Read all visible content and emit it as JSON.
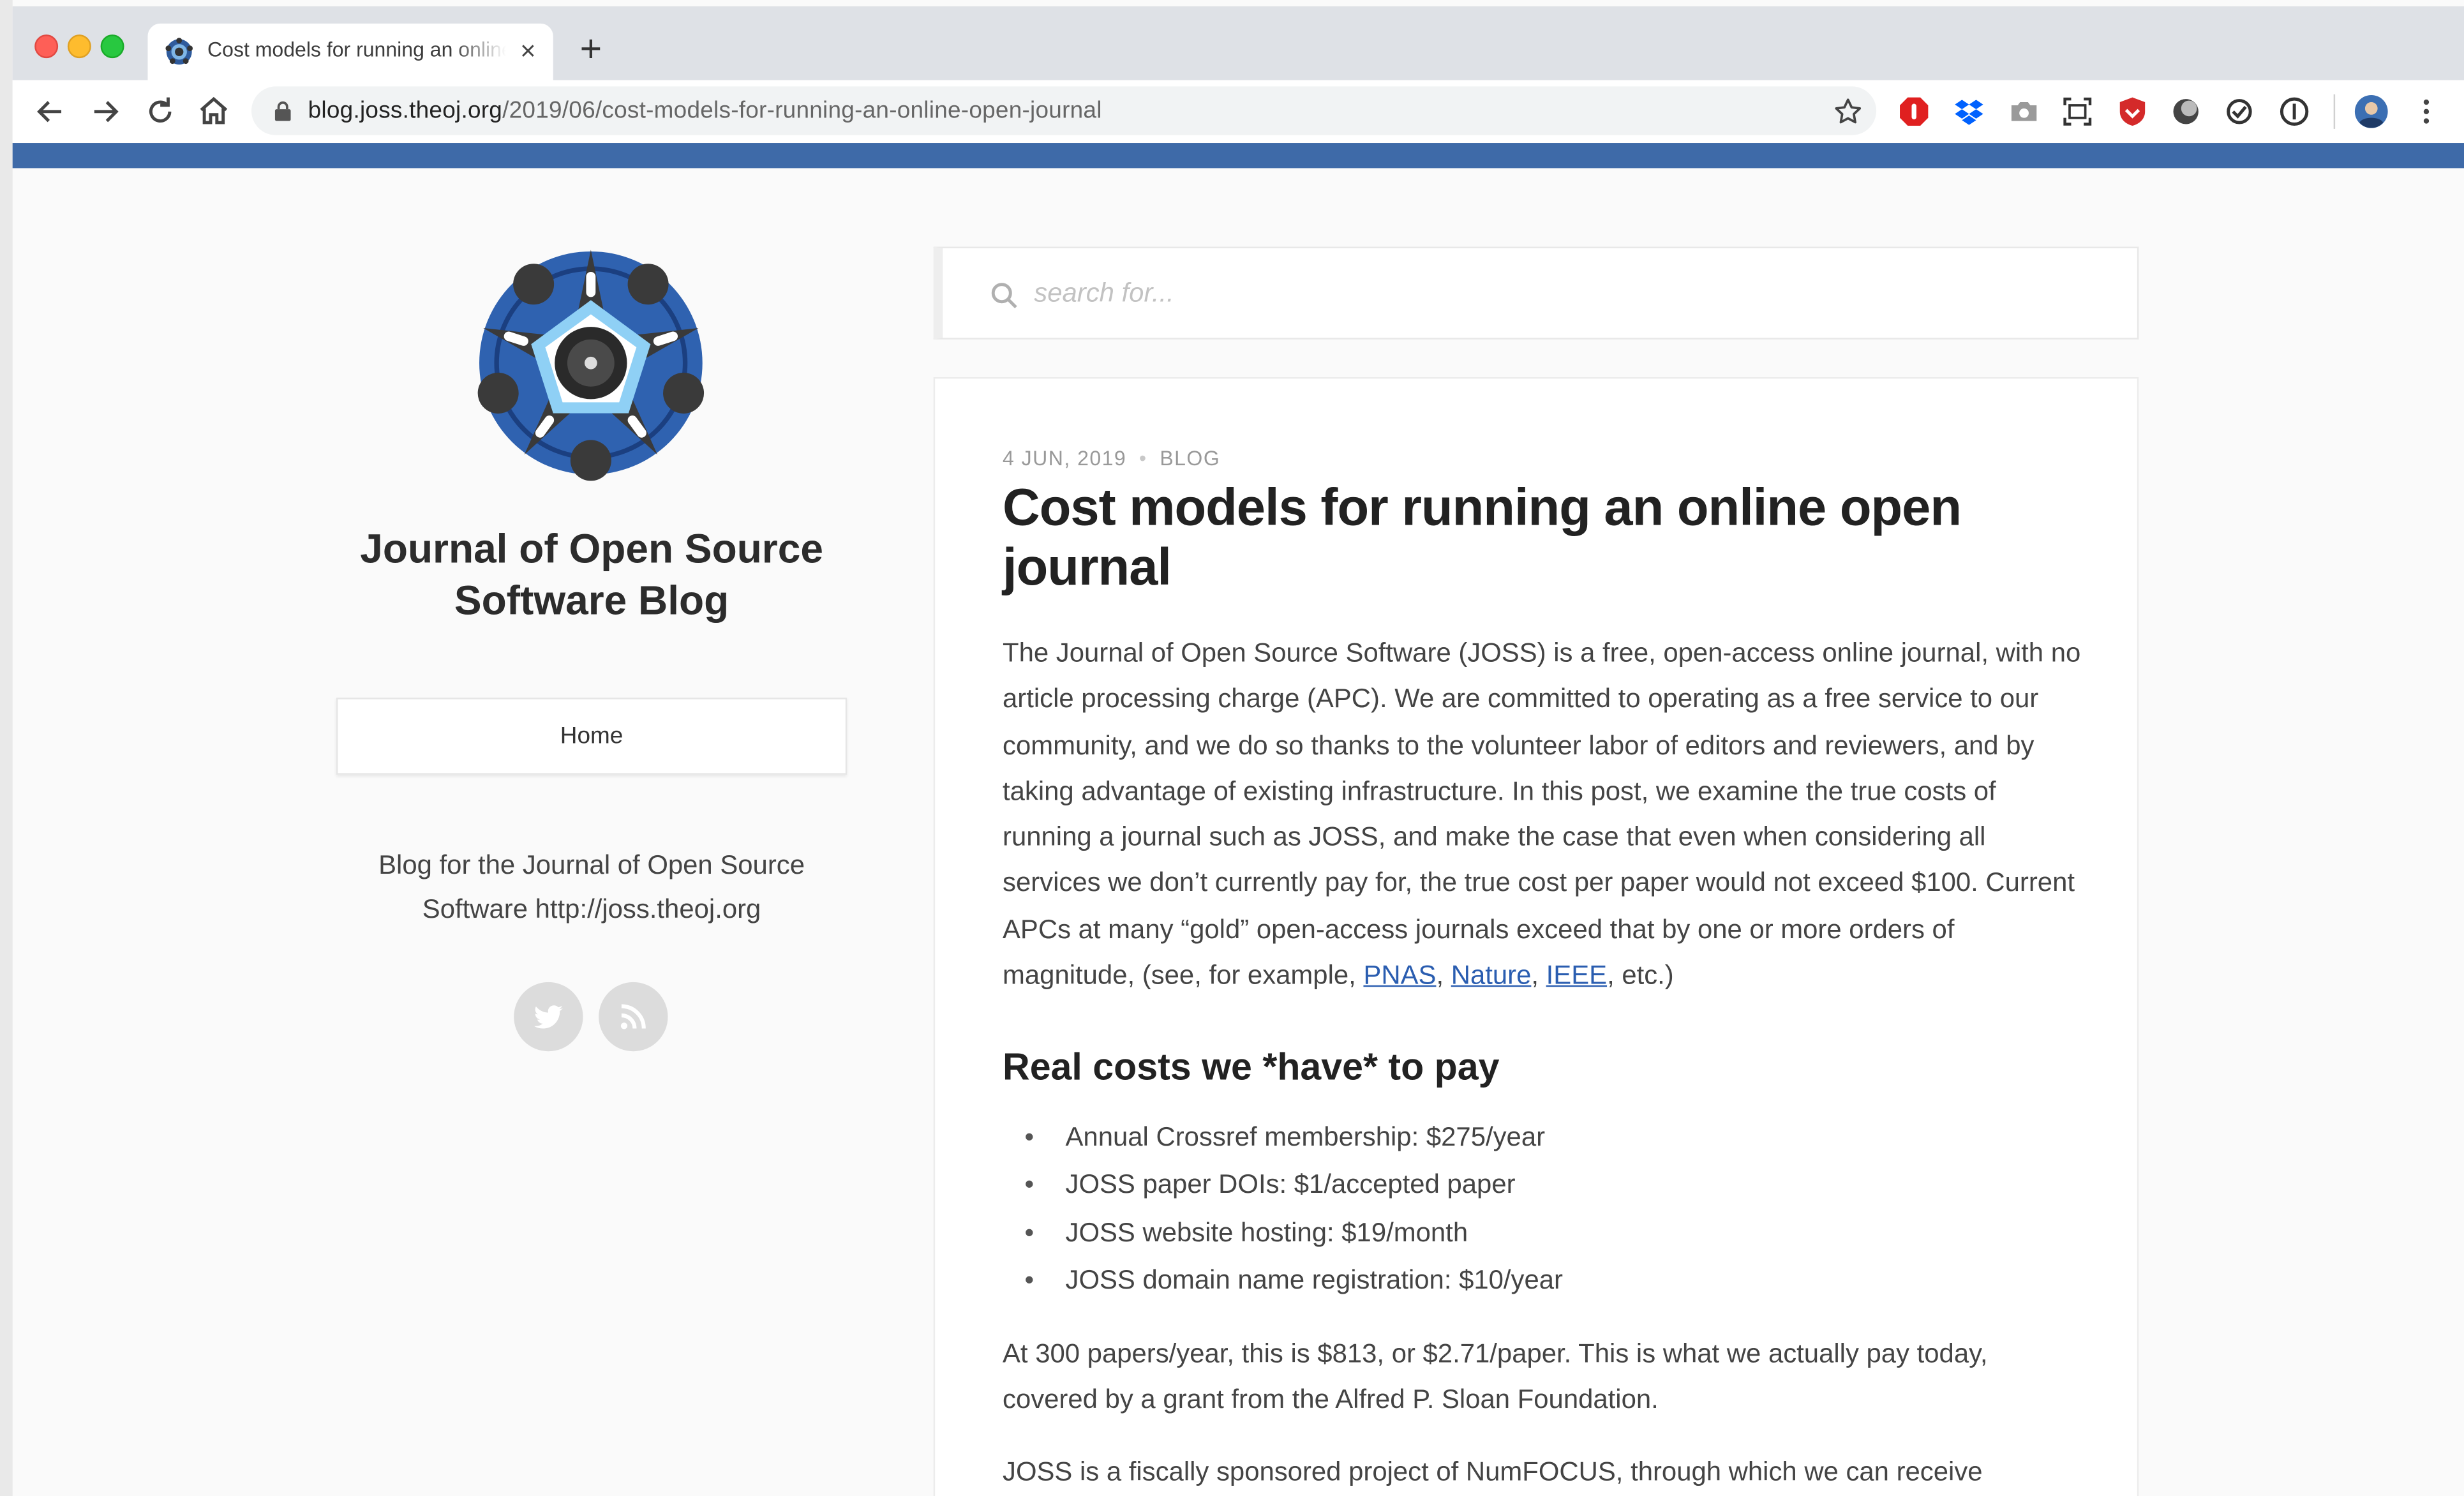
{
  "browser": {
    "tab_title": "Cost models for running an online open journal",
    "tab_close": "×",
    "new_tab": "+",
    "url_domain": "blog.joss.theoj.org",
    "url_path": "/2019/06/cost-models-for-running-an-online-open-journal",
    "accent_color": "#3e6aa8"
  },
  "sidebar": {
    "site_title": "Journal of Open Source Software Blog",
    "home_label": "Home",
    "description": "Blog for the Journal of Open Source Software http://joss.theoj.org",
    "social_icons": [
      "twitter-icon",
      "rss-icon"
    ]
  },
  "search": {
    "placeholder": "search for..."
  },
  "post": {
    "date": "4 JUN, 2019",
    "separator": "•",
    "category": "BLOG",
    "title": "Cost models for running an online open journal",
    "intro": "The Journal of Open Source Software (JOSS) is a free, open-access online journal, with no article processing charge (APC). We are committed to operating as a free service to our community, and we do so thanks to the volunteer labor of editors and reviewers, and by taking advantage of existing infrastructure. In this post, we examine the true costs of running a journal such as JOSS, and make the case that even when considering all services we don’t currently pay for, the true cost per paper would not exceed $100. Current APCs at many “gold” open-access journals exceed that by one or more orders of magnitude, (see, for example, ",
    "links": [
      "PNAS",
      "Nature",
      "IEEE"
    ],
    "link_sep_1": ", ",
    "link_sep_2": ", ",
    "intro_end": ", etc.)",
    "section_heading": "Real costs we *have* to pay",
    "costs": [
      "Annual Crossref membership: $275/year",
      "JOSS paper DOIs: $1/accepted paper",
      "JOSS website hosting: $19/month",
      "JOSS domain name registration: $10/year"
    ],
    "paragraph_2": "At 300 papers/year, this is $813, or $2.71/paper. This is what we actually pay today, covered by a grant from the Alfred P. Sloan Foundation.",
    "paragraph_3": "JOSS is a fiscally sponsored project of NumFOCUS, through which we can receive"
  }
}
